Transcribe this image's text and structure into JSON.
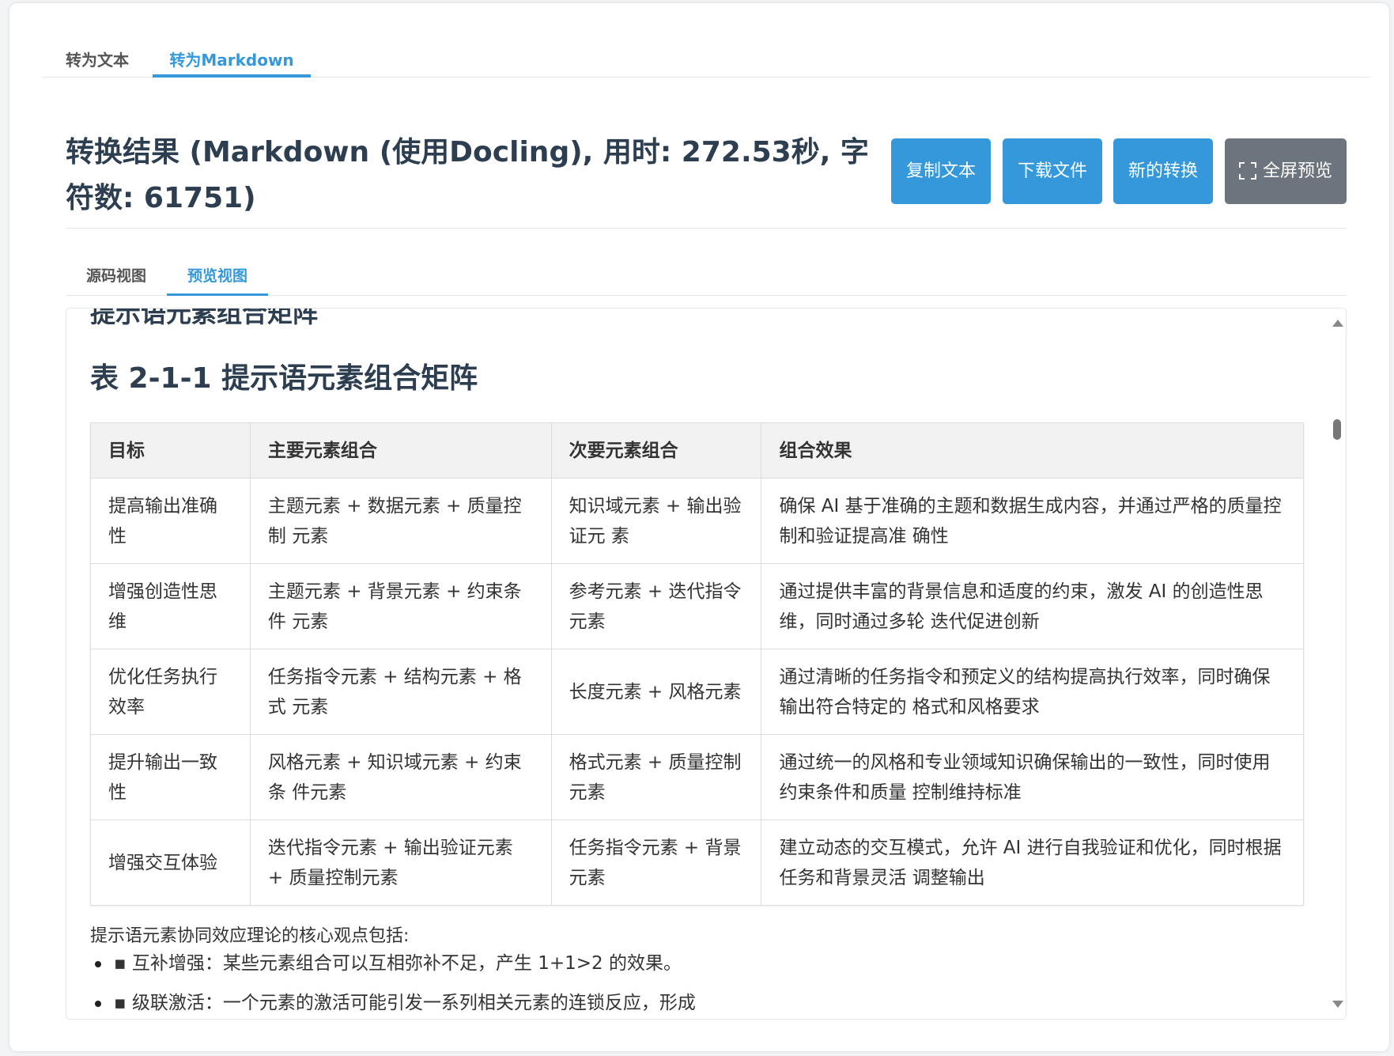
{
  "tabs": {
    "text_label": "转为文本",
    "markdown_label": "转为Markdown"
  },
  "result": {
    "title": "转换结果 (Markdown (使用Docling), 用时: 272.53秒, 字符数: 61751)",
    "copy_label": "复制文本",
    "download_label": "下载文件",
    "new_label": "新的转换",
    "fullscreen_label": "全屏预览"
  },
  "view_tabs": {
    "source_label": "源码视图",
    "preview_label": "预览视图"
  },
  "preview": {
    "cut_heading": "提示语元素组合矩阵",
    "table_title": "表 2-1-1 提示语元素组合矩阵",
    "table": {
      "headers": [
        "目标",
        "主要元素组合",
        "次要元素组合",
        "组合效果"
      ],
      "rows": [
        [
          "提高输出准确性",
          "主题元素 + 数据元素 + 质量控制 元素",
          "知识域元素 + 输出验证元 素",
          "确保 AI 基于准确的主题和数据生成内容，并通过严格的质量控制和验证提高准 确性"
        ],
        [
          "增强创造性思维",
          "主题元素 + 背景元素 + 约束条件 元素",
          "参考元素 + 迭代指令元素",
          "通过提供丰富的背景信息和适度的约束，激发 AI 的创造性思维，同时通过多轮 迭代促进创新"
        ],
        [
          "优化任务执行效率",
          "任务指令元素 + 结构元素 + 格式 元素",
          "长度元素 + 风格元素",
          "通过清晰的任务指令和预定义的结构提高执行效率，同时确保输出符合特定的 格式和风格要求"
        ],
        [
          "提升输出一致性",
          "风格元素 + 知识域元素 + 约束条 件元素",
          "格式元素 + 质量控制元素",
          "通过统一的风格和专业领域知识确保输出的一致性，同时使用约束条件和质量 控制维持标准"
        ],
        [
          "增强交互体验",
          "迭代指令元素 + 输出验证元素 + 质量控制元素",
          "任务指令元素 + 背景元素",
          "建立动态的交互模式，允许 AI 进行自我验证和优化，同时根据任务和背景灵活 调整输出"
        ]
      ]
    },
    "paragraph": "提示语元素协同效应理论的核心观点包括:",
    "bullets": [
      "▪ 互补增强：某些元素组合可以互相弥补不足，产生 1+1>2 的效果。",
      "▪ 级联激活：一个元素的激活可能引发一系列相关元素的连锁反应，形成"
    ]
  },
  "colors": {
    "accent": "#3498db",
    "gray_button": "#6c757d",
    "heading": "#2c3e50"
  }
}
